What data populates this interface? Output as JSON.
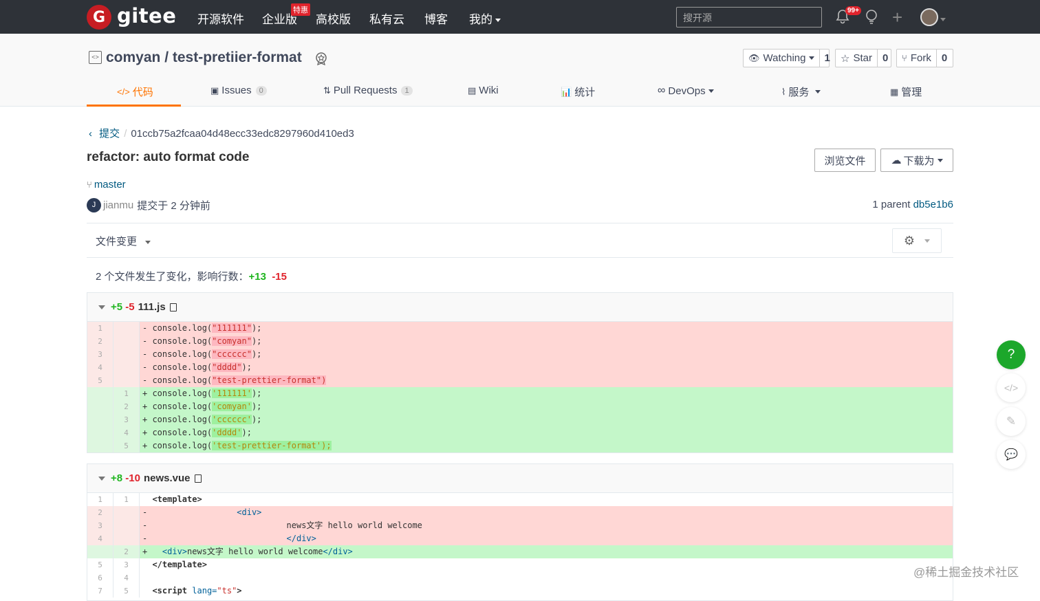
{
  "topnav": {
    "logo_letter": "G",
    "logo_text": "gitee",
    "items": [
      "开源软件",
      "企业版",
      "高校版",
      "私有云",
      "博客",
      "我的"
    ],
    "enterprise_badge": "特惠",
    "search_placeholder": "搜开源",
    "notification_count": "99+"
  },
  "repo": {
    "name": "comyan / test-pretiier-format",
    "watching_label": "Watching",
    "watching_count": "1",
    "star_label": "Star",
    "star_count": "0",
    "fork_label": "Fork",
    "fork_count": "0"
  },
  "tabs": [
    {
      "label": "代码"
    },
    {
      "label": "Issues",
      "count": "0"
    },
    {
      "label": "Pull Requests",
      "count": "1"
    },
    {
      "label": "Wiki"
    },
    {
      "label": "统计"
    },
    {
      "label": "DevOps"
    },
    {
      "label": "服务"
    },
    {
      "label": "管理"
    }
  ],
  "commit": {
    "breadcrumb_link": "提交",
    "hash": "01ccb75a2fcaa04d48ecc33edc8297960d410ed3",
    "title": "refactor: auto format code",
    "browse_button": "浏览文件",
    "download_button": "下载为",
    "branch": "master",
    "author_initial": "J",
    "author": "jianmu",
    "committed_text": "提交于 2 分钟前",
    "parent_label": "1 parent",
    "parent_hash": "db5e1b6"
  },
  "files_bar": {
    "label": "文件变更"
  },
  "summary": {
    "text": "2 个文件发生了变化，影响行数：",
    "additions": "+13",
    "deletions": "-15"
  },
  "diffs": [
    {
      "additions": "+5",
      "deletions": "-5",
      "filename": "111.js"
    },
    {
      "additions": "+8",
      "deletions": "-10",
      "filename": "news.vue"
    }
  ],
  "watermark": "@稀土掘金技术社区",
  "help_button": "?"
}
